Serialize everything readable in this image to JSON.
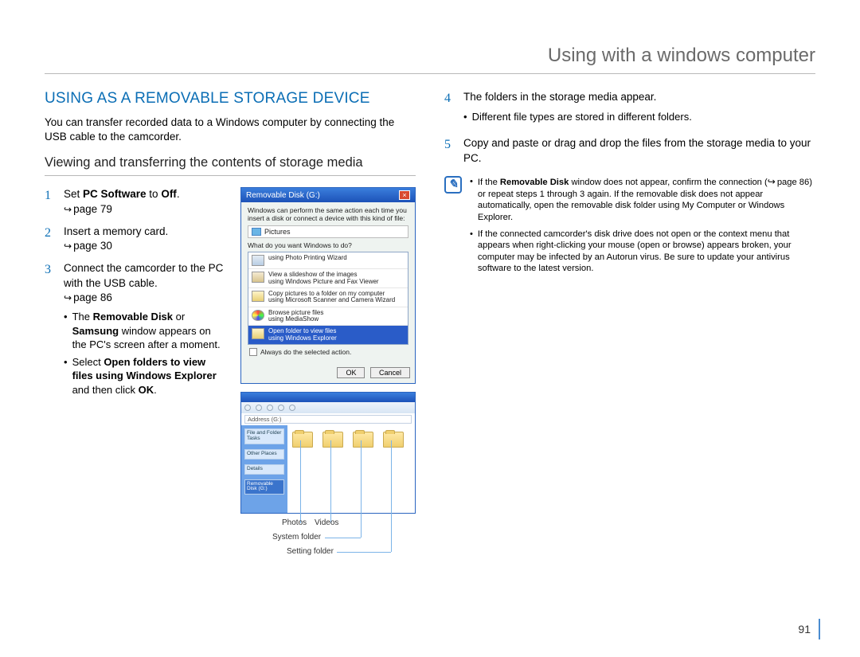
{
  "header": {
    "title": "Using with a windows computer"
  },
  "left": {
    "section_title": "USING AS A REMOVABLE STORAGE DEVICE",
    "intro": "You can transfer recorded data to a Windows computer by connecting the USB cable to the camcorder.",
    "subhead": "Viewing and transferring the contents of storage media",
    "steps": {
      "s1": {
        "num": "1",
        "t1": "Set ",
        "b1": "PC Software",
        "t2": " to ",
        "b2": "Off",
        "t3": ".",
        "ref": "page 79"
      },
      "s2": {
        "num": "2",
        "text": "Insert a memory card.",
        "ref": "page 30"
      },
      "s3": {
        "num": "3",
        "text": "Connect the camcorder to the PC with the USB cable.",
        "ref": "page 86",
        "b1": {
          "t1": "The ",
          "bold1": "Removable Disk",
          "t2": " or ",
          "bold2": "Samsung",
          "t3": " window appears on the PC's screen after a moment."
        },
        "b2": {
          "t1": "Select ",
          "bold1": "Open folders to view files using Windows Explorer",
          "t2": " and then click ",
          "bold2": "OK",
          "t3": "."
        }
      }
    }
  },
  "dialog": {
    "title": "Removable Disk (G:)",
    "msg": "Windows can perform the same action each time you insert a disk or connect a device with this kind of file:",
    "pictures": "Pictures",
    "prompt": "What do you want Windows to do?",
    "items": [
      {
        "l1": "using Photo Printing Wizard",
        "cls": "printer"
      },
      {
        "l1": "View a slideshow of the images",
        "l2": "using Windows Picture and Fax Viewer",
        "cls": "slides"
      },
      {
        "l1": "Copy pictures to a folder on my computer",
        "l2": "using Microsoft Scanner and Camera Wizard",
        "cls": "folder2"
      },
      {
        "l1": "Browse picture files",
        "l2": "using MediaShow",
        "cls": "media"
      },
      {
        "l1": "Open folder to view files",
        "l2": "using Windows Explorer",
        "cls": "folderopen",
        "sel": true
      }
    ],
    "always": "Always do the selected action.",
    "ok": "OK",
    "cancel": "Cancel"
  },
  "explorer": {
    "addr": "Address (G:)",
    "side": {
      "a": "File and Folder Tasks",
      "b": "Other Places",
      "c": "Details",
      "d": "Removable Disk (G:)"
    },
    "folders": [
      "",
      "",
      "",
      ""
    ]
  },
  "callouts": {
    "photos": "Photos",
    "videos": "Videos",
    "system": "System folder",
    "setting": "Setting folder"
  },
  "right": {
    "s4": {
      "num": "4",
      "text": "The folders in the storage media appear.",
      "b1": "Different file types are stored in different folders."
    },
    "s5": {
      "num": "5",
      "text": "Copy and paste or drag and drop the files from the storage media to your PC."
    },
    "note1": {
      "t1": "If the ",
      "b1": "Removable Disk",
      "t2": " window does not appear, confirm the connection (",
      "ref": "page 86",
      "t3": ") or repeat steps 1 through 3 again. If the removable disk does not appear automatically, open the removable disk folder using My Computer or Windows Explorer."
    },
    "note2": "If the connected camcorder's disk drive does not open or the context menu that appears when right-clicking your mouse (open or browse) appears broken, your computer may be infected by an Autorun virus. Be sure to update your antivirus software to the latest version."
  },
  "pagenum": "91"
}
